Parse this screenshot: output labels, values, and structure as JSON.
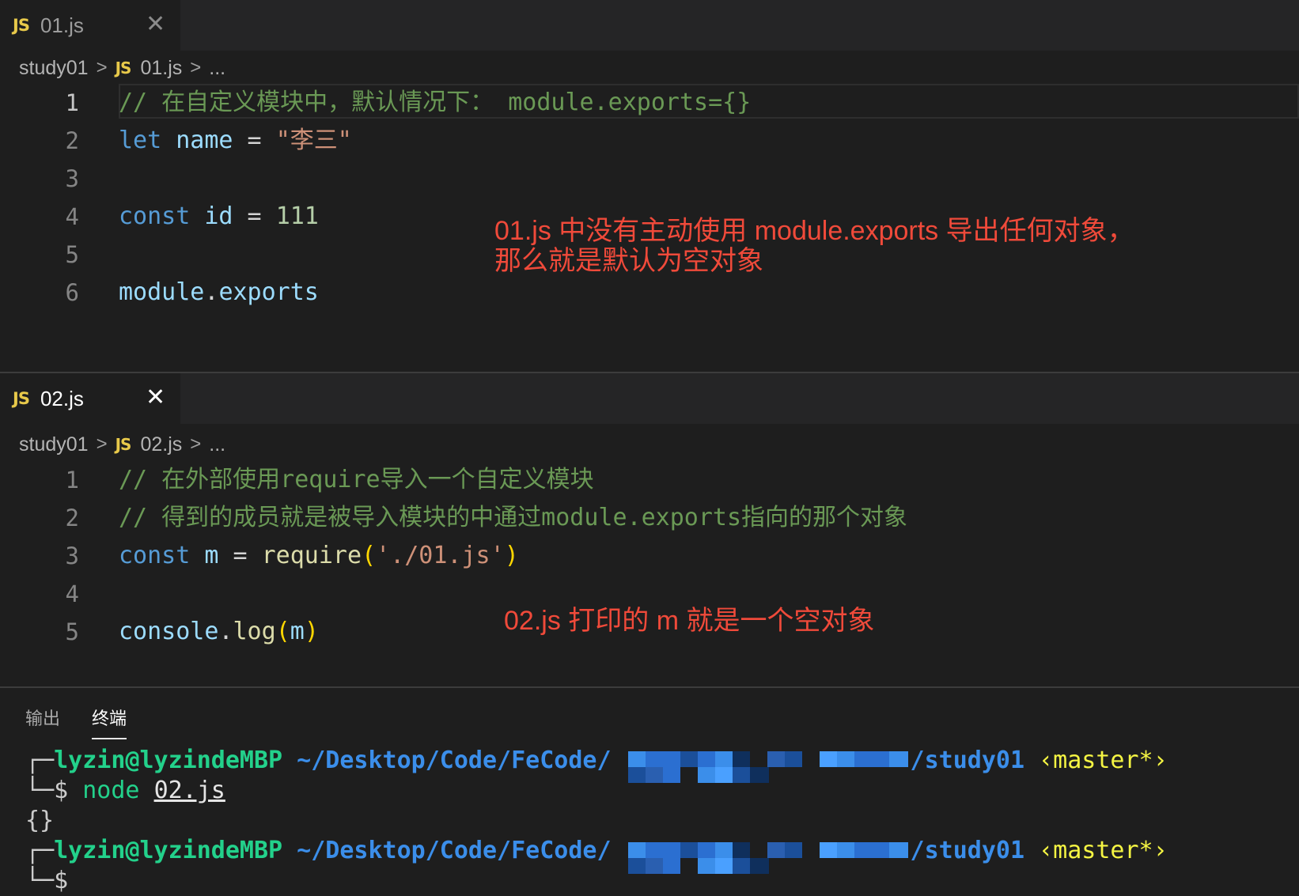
{
  "editor_top": {
    "tab": {
      "icon": "JS",
      "name": "01.js",
      "close": "✕"
    },
    "breadcrumb": {
      "folder": "study01",
      "icon": "JS",
      "file": "01.js",
      "more": "..."
    },
    "lines": [
      {
        "n": "1",
        "tokens": [
          {
            "t": "// 在自定义模块中，默认情况下： module.exports={}",
            "c": "cm"
          }
        ]
      },
      {
        "n": "2",
        "tokens": [
          {
            "t": "let",
            "c": "kw"
          },
          {
            "t": " ",
            "c": "op"
          },
          {
            "t": "name",
            "c": "var"
          },
          {
            "t": " = ",
            "c": "op"
          },
          {
            "t": "\"李三\"",
            "c": "str"
          }
        ]
      },
      {
        "n": "3",
        "tokens": []
      },
      {
        "n": "4",
        "tokens": [
          {
            "t": "const",
            "c": "kw"
          },
          {
            "t": " ",
            "c": "op"
          },
          {
            "t": "id",
            "c": "var"
          },
          {
            "t": " = ",
            "c": "op"
          },
          {
            "t": "111",
            "c": "num"
          }
        ]
      },
      {
        "n": "5",
        "tokens": []
      },
      {
        "n": "6",
        "tokens": [
          {
            "t": "module",
            "c": "var"
          },
          {
            "t": ".",
            "c": "op"
          },
          {
            "t": "exports",
            "c": "var"
          }
        ]
      }
    ],
    "annotation_1": "01.js 中没有主动使用 module.exports 导出任何对象，",
    "annotation_2": "那么就是默认为空对象"
  },
  "editor_bottom": {
    "tab": {
      "icon": "JS",
      "name": "02.js",
      "close": "✕"
    },
    "breadcrumb": {
      "folder": "study01",
      "icon": "JS",
      "file": "02.js",
      "more": "..."
    },
    "lines": [
      {
        "n": "1",
        "tokens": [
          {
            "t": "// 在外部使用require导入一个自定义模块",
            "c": "cm"
          }
        ]
      },
      {
        "n": "2",
        "tokens": [
          {
            "t": "// 得到的成员就是被导入模块的中通过module.exports指向的那个对象",
            "c": "cm"
          }
        ]
      },
      {
        "n": "3",
        "tokens": [
          {
            "t": "const",
            "c": "kw"
          },
          {
            "t": " ",
            "c": "op"
          },
          {
            "t": "m",
            "c": "var"
          },
          {
            "t": " = ",
            "c": "op"
          },
          {
            "t": "require",
            "c": "fn"
          },
          {
            "t": "(",
            "c": "br"
          },
          {
            "t": "'./01.js'",
            "c": "str"
          },
          {
            "t": ")",
            "c": "br"
          }
        ]
      },
      {
        "n": "4",
        "tokens": []
      },
      {
        "n": "5",
        "tokens": [
          {
            "t": "console",
            "c": "var"
          },
          {
            "t": ".",
            "c": "op"
          },
          {
            "t": "log",
            "c": "fn"
          },
          {
            "t": "(",
            "c": "br"
          },
          {
            "t": "m",
            "c": "var"
          },
          {
            "t": ")",
            "c": "br"
          }
        ]
      }
    ],
    "annotation": "02.js 打印的 m 就是一个空对象"
  },
  "panel": {
    "tabs": [
      "输出",
      "终端"
    ],
    "terminal": {
      "box_top": "┌─",
      "box_bottom": "└─",
      "user": "lyzin@lyzindeMBP",
      "path_prefix": "~/Desktop/Code/FeCode/",
      "path_suffix": "/study01",
      "branch": "‹master*›",
      "prompt": "$",
      "command": "node",
      "argument": "02.js",
      "output": "{}"
    }
  },
  "colors": {
    "background": "#1e1e1e",
    "annotation": "#f04a3a",
    "comment": "#6a9955",
    "keyword": "#569cd6",
    "variable": "#9cdcfe",
    "string": "#ce9178",
    "terminal_green": "#23d18b",
    "terminal_blue": "#3b8eea",
    "terminal_yellow": "#f5f543"
  }
}
